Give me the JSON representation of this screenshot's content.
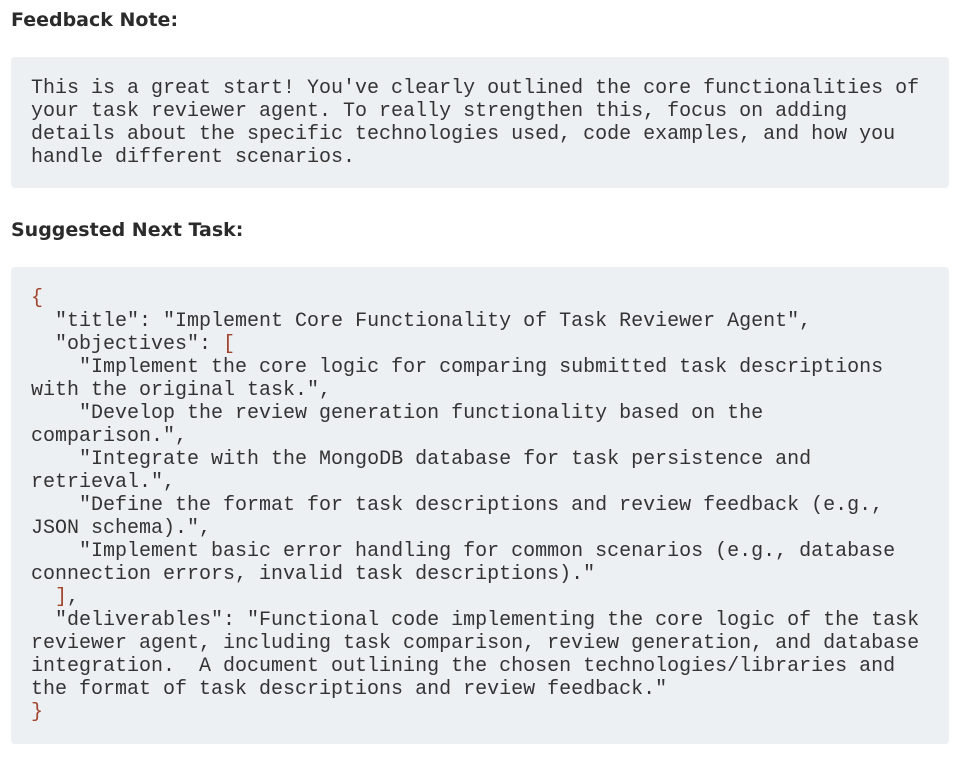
{
  "feedback": {
    "heading": "Feedback Note:",
    "text": "This is a great start! You've clearly outlined the core functionalities of your task reviewer agent. To really strengthen this, focus on adding details about the specific technologies used, code examples, and how you handle different scenarios."
  },
  "next_task": {
    "heading": "Suggested Next Task:",
    "keys": {
      "title": "title",
      "objectives": "objectives",
      "deliverables": "deliverables"
    },
    "title": "Implement Core Functionality of Task Reviewer Agent",
    "objectives": [
      "Implement the core logic for comparing submitted task descriptions with the original task.",
      "Develop the review generation functionality based on the comparison.",
      "Integrate with the MongoDB database for task persistence and retrieval.",
      "Define the format for task descriptions and review feedback (e.g., JSON schema).",
      "Implement basic error handling for common scenarios (e.g., database connection errors, invalid task descriptions)."
    ],
    "deliverables": "Functional code implementing the core logic of the task reviewer agent, including task comparison, review generation, and database integration.  A document outlining the chosen technologies/libraries and the format of task descriptions and review feedback.",
    "colors": {
      "punctuation": "#a0442d",
      "text": "#333333",
      "background": "#edf0f3"
    }
  }
}
